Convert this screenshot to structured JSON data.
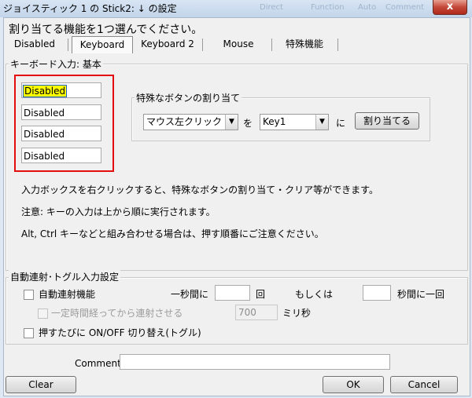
{
  "window": {
    "title": "ジョイスティック 1 の Stick2: ↓ の設定",
    "close_label": "x",
    "background_titles": [
      "Direct",
      "Function",
      "Auto",
      "Comment"
    ]
  },
  "instruction": "割り当てる機能を1つ選んでください。",
  "tabs": [
    {
      "label": "Disabled",
      "active": false
    },
    {
      "label": "Keyboard",
      "active": true
    },
    {
      "label": "Keyboard 2",
      "active": false
    },
    {
      "label": "Mouse",
      "active": false
    },
    {
      "label": "特殊機能",
      "active": false
    }
  ],
  "keyboard_group": {
    "title": "キーボード入力: 基本",
    "key_inputs": [
      "Disabled",
      "Disabled",
      "Disabled",
      "Disabled"
    ],
    "special": {
      "title": "特殊なボタンの割り当て",
      "mouse_select": "マウス左クリック",
      "wo_label": "を",
      "key_select": "Key1",
      "ni_label": "に",
      "assign_button": "割り当てる"
    },
    "notes": [
      "入力ボックスを右クリックすると、特殊なボタンの割り当て・クリア等ができます。",
      "注意: キーの入力は上から順に実行されます。",
      "Alt, Ctrl キーなどと組み合わせる場合は、押す順番にご注意ください。"
    ]
  },
  "auto_group": {
    "title": "自動連射･トグル入力設定",
    "rapid_fire_label": "自動連射機能",
    "per_second_label": "一秒間に",
    "times_label": "回",
    "or_label": "もしくは",
    "seconds_per_once_label": "秒間に一回",
    "delay_label": "一定時間経ってから連射させる",
    "delay_value": "700",
    "ms_label": "ミリ秒",
    "toggle_label": "押すたびに ON/OFF 切り替え(トグル)"
  },
  "comment": {
    "label": "Comment:",
    "value": ""
  },
  "buttons": {
    "clear": "Clear",
    "ok": "OK",
    "cancel": "Cancel"
  },
  "colors": {
    "highlight_border": "#e30d0d",
    "selected_text_bg": "#ffff00"
  }
}
